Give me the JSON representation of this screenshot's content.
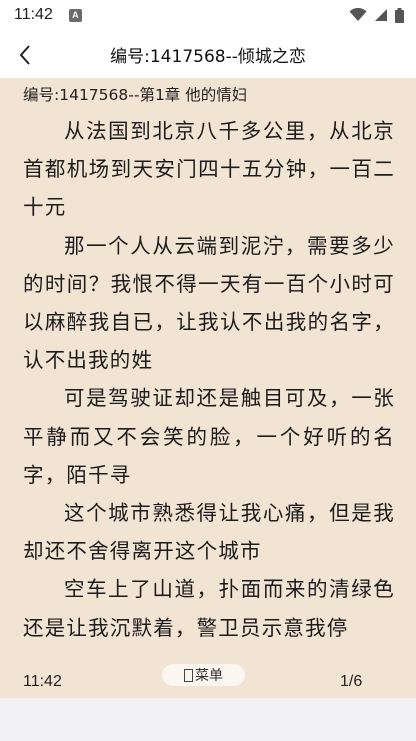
{
  "status_bar": {
    "time": "11:42",
    "notification_badge": "A",
    "icons": [
      "wifi-icon",
      "signal-icon",
      "battery-icon"
    ]
  },
  "app_bar": {
    "title": "编号:1417568--倾城之恋",
    "back_icon": "chevron-left-icon"
  },
  "reader": {
    "chapter_title": "编号:1417568--第1章 他的情妇",
    "paragraphs": [
      "从法国到北京八千多公里，从北京首都机场到天安门四十五分钟，一百二十元",
      "那一个人从云端到泥泞，需要多少的时间？我恨不得一天有一百个小时可以麻醉我自已，让我认不出我的名字，认不出我的姓",
      "可是驾驶证却还是触目可及，一张平静而又不会笑的脸，一个好听的名字，陌千寻",
      "这个城市熟悉得让我心痛，但是我却还不舍得离开这个城市",
      "空车上了山道，扑面而来的清绿色还是让我沉默着，警卫员示意我停"
    ],
    "background_color": "#f1e4d3"
  },
  "footer": {
    "time": "11:42",
    "menu_label": "菜单",
    "page_indicator": "1/6"
  }
}
